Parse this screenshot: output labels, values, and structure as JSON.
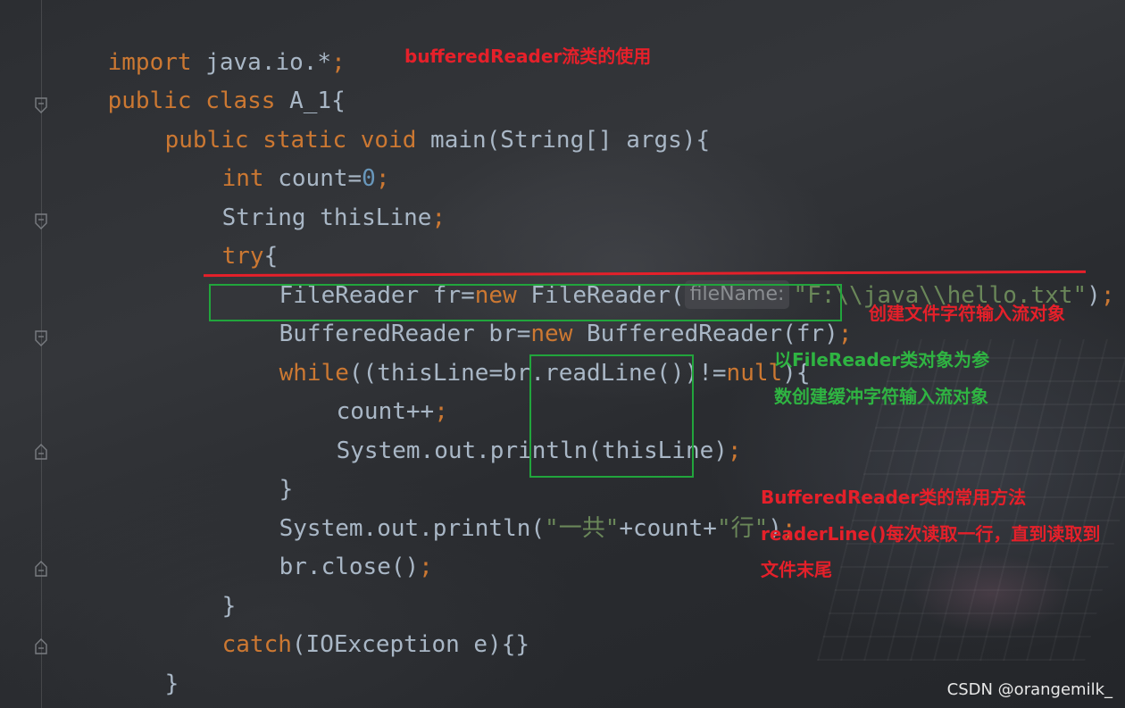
{
  "code": {
    "l1": {
      "a": "import",
      "b": " java.io.*",
      "c": ";"
    },
    "l2": {
      "a": "public class",
      "b": " A_1{"
    },
    "l3": {
      "a": "public static void",
      "b": " main(String[] args){"
    },
    "l4": {
      "a": "int",
      "b": " count=",
      "c": "0",
      "d": ";"
    },
    "l5": {
      "a": "String thisLine",
      "b": ";"
    },
    "l6": {
      "a": "try",
      "b": "{"
    },
    "l7": {
      "a": "FileReader fr=",
      "b": "new",
      "c": " FileReader(",
      "hint": "fileName:",
      "d": "\"F:\\\\java\\\\hello.txt\"",
      "e": ")",
      "f": ";"
    },
    "l8": {
      "a": "BufferedReader br=",
      "b": "new",
      "c": " BufferedReader(fr)",
      "d": ";"
    },
    "l9": {
      "a": "while",
      "b": "((thisLine=br.readLine())!=",
      "c": "null",
      "d": "){"
    },
    "l10": {
      "a": "count++",
      "b": ";"
    },
    "l11": {
      "a": "System.out.println(thisLine)",
      "b": ";"
    },
    "l12": {
      "a": "}"
    },
    "l13": {
      "a": "System.out.println(",
      "b": "\"一共\"",
      "c": "+count+",
      "d": "\"行\"",
      "e": ")",
      "f": ";"
    },
    "l14": {
      "a": "br.close()",
      "b": ";"
    },
    "l15": {
      "a": "}"
    },
    "l16": {
      "a": "catch",
      "b": "(IOException e){}"
    },
    "l17": {
      "a": "}"
    },
    "l18": {
      "a": "}"
    }
  },
  "annotations": {
    "title": "bufferedReader流类的使用",
    "create_file_reader": "创建文件字符输入流对象",
    "param_line1": "以FileReader类对象为参",
    "param_line2": "数创建缓冲字符输入流对象",
    "methods_line1": "BufferedReader类的常用方法",
    "methods_line2": "readerLine()每次读取一行，直到读取到",
    "methods_line3": "文件末尾"
  },
  "colors": {
    "keyword": "#cc7832",
    "number": "#6897bb",
    "string": "#6a8759",
    "plain": "#a9b7c6",
    "annotation_red": "#e5202a",
    "annotation_green": "#2fb442"
  },
  "watermark": "CSDN @orangemilk_"
}
